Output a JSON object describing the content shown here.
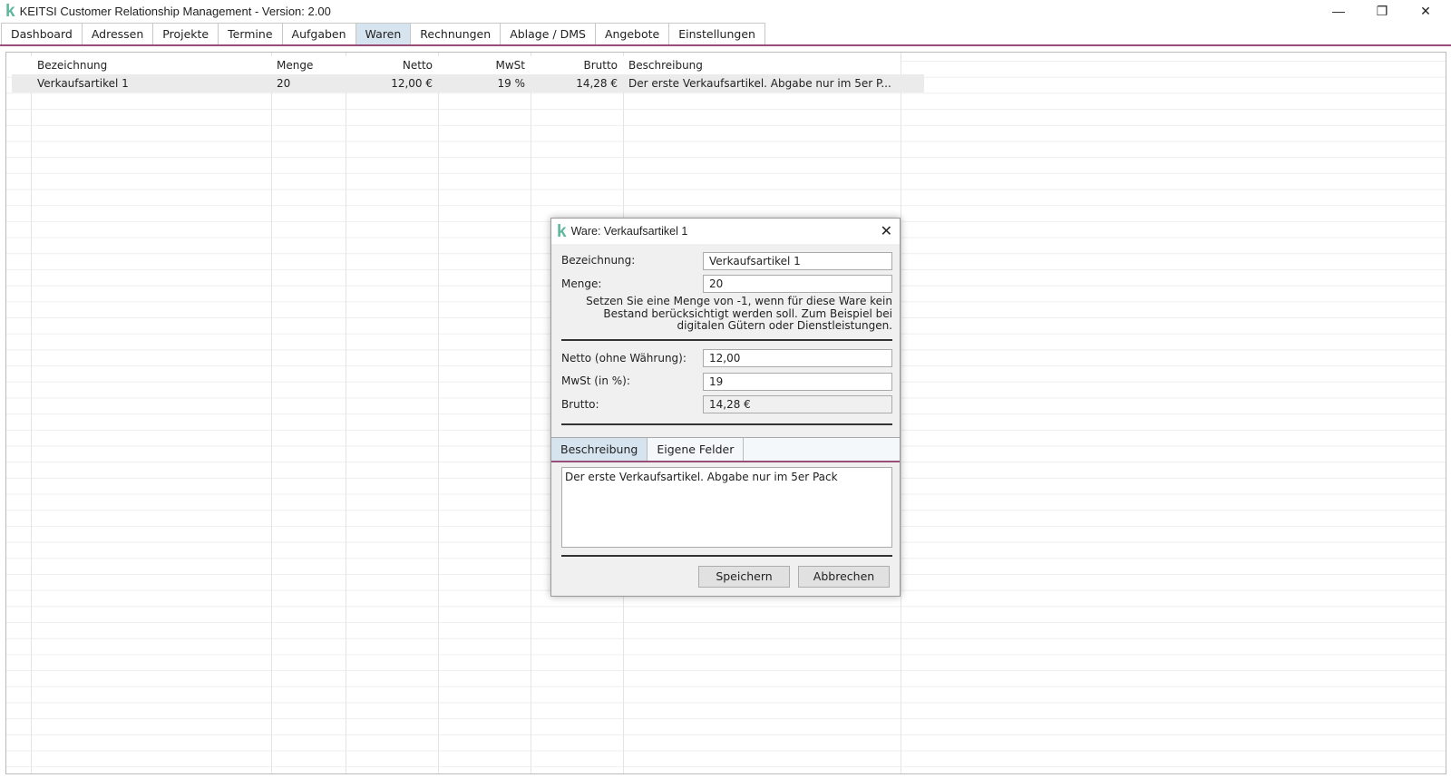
{
  "window": {
    "title": "KEITSI Customer Relationship Management - Version: 2.00",
    "logo": "k",
    "minimize": "—",
    "restore": "❐",
    "close": "✕"
  },
  "tabs": [
    "Dashboard",
    "Adressen",
    "Projekte",
    "Termine",
    "Aufgaben",
    "Waren",
    "Rechnungen",
    "Ablage / DMS",
    "Angebote",
    "Einstellungen"
  ],
  "active_tab": "Waren",
  "table": {
    "columns": [
      "Bezeichnung",
      "Menge",
      "Netto",
      "MwSt",
      "Brutto",
      "Beschreibung"
    ],
    "rows": [
      [
        "Verkaufsartikel 1",
        "20",
        "12,00 €",
        "19 %",
        "14,28 €",
        "Der erste Verkaufsartikel. Abgabe nur im 5er P..."
      ]
    ]
  },
  "dialog": {
    "title": "Ware: Verkaufsartikel 1",
    "close": "✕",
    "bezeichnung_label": "Bezeichnung:",
    "bezeichnung": "Verkaufsartikel 1",
    "menge_label": "Menge:",
    "menge": "20",
    "note": "Setzen Sie eine Menge von -1, wenn für diese Ware kein Bestand berücksichtigt werden soll. Zum Beispiel bei digitalen Gütern oder Dienstleistungen.",
    "netto_label": "Netto (ohne Währung):",
    "netto": "12,00",
    "mwst_label": "MwSt (in %):",
    "mwst": "19",
    "brutto_label": "Brutto:",
    "brutto": "14,28 €",
    "tabs": [
      "Beschreibung",
      "Eigene Felder"
    ],
    "beschreibung": "Der erste Verkaufsartikel. Abgabe nur im 5er Pack",
    "save": "Speichern",
    "cancel": "Abbrechen"
  }
}
